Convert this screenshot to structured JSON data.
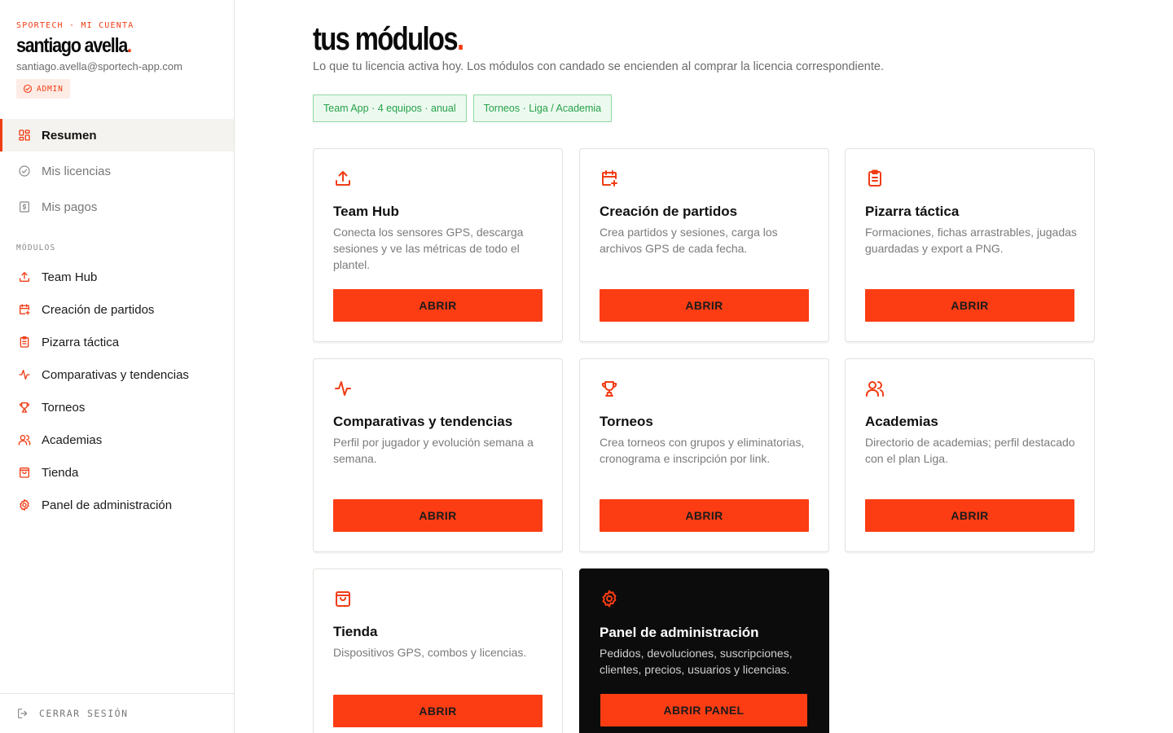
{
  "colors": {
    "accent": "#fc3d14",
    "chip_text": "#27a24a",
    "chip_bg": "#ecf9ef",
    "dark_card": "#0c0c0c"
  },
  "sidebar": {
    "eyebrow": "SPORTECH · MI CUENTA",
    "user_name": "santiago avella",
    "user_name_dot": ".",
    "email": "santiago.avella@sportech-app.com",
    "role_badge": "ADMIN",
    "account_nav": [
      {
        "label": "Resumen",
        "icon": "dashboard-grid-icon",
        "active": true
      },
      {
        "label": "Mis licencias",
        "icon": "check-circle-icon"
      },
      {
        "label": "Mis pagos",
        "icon": "receipt-dollar-icon"
      }
    ],
    "modules_label": "MÓDULOS",
    "modules_nav": [
      {
        "label": "Team Hub",
        "icon": "upload-icon"
      },
      {
        "label": "Creación de partidos",
        "icon": "calendar-plus-icon"
      },
      {
        "label": "Pizarra táctica",
        "icon": "clipboard-icon"
      },
      {
        "label": "Comparativas y tendencias",
        "icon": "activity-icon"
      },
      {
        "label": "Torneos",
        "icon": "trophy-icon"
      },
      {
        "label": "Academias",
        "icon": "users-icon"
      },
      {
        "label": "Tienda",
        "icon": "shopping-bag-icon"
      },
      {
        "label": "Panel de administración",
        "icon": "gear-icon"
      }
    ],
    "logout_label": "CERRAR SESIÓN"
  },
  "main": {
    "title": "tus módulos",
    "title_dot": ".",
    "subtitle": "Lo que tu licencia activa hoy. Los módulos con candado se encienden al comprar la licencia correspondiente.",
    "chips": [
      "Team App · 4 equipos · anual",
      "Torneos · Liga / Academia"
    ],
    "cards": [
      {
        "title": "Team Hub",
        "description": "Conecta los sensores GPS, descarga sesiones y ve las métricas de todo el plantel.",
        "button": "ABRIR",
        "icon": "upload-icon"
      },
      {
        "title": "Creación de partidos",
        "description": "Crea partidos y sesiones, carga los archivos GPS de cada fecha.",
        "button": "ABRIR",
        "icon": "calendar-plus-icon"
      },
      {
        "title": "Pizarra táctica",
        "description": "Formaciones, fichas arrastrables, jugadas guardadas y export a PNG.",
        "button": "ABRIR",
        "icon": "clipboard-icon"
      },
      {
        "title": "Comparativas y tendencias",
        "description": "Perfil por jugador y evolución semana a semana.",
        "button": "ABRIR",
        "icon": "activity-icon"
      },
      {
        "title": "Torneos",
        "description": "Crea torneos con grupos y eliminatorias, cronograma e inscripción por link.",
        "button": "ABRIR",
        "icon": "trophy-icon"
      },
      {
        "title": "Academias",
        "description": "Directorio de academias; perfil destacado con el plan Liga.",
        "button": "ABRIR",
        "icon": "users-icon"
      },
      {
        "title": "Tienda",
        "description": "Dispositivos GPS, combos y licencias.",
        "button": "ABRIR",
        "icon": "shopping-bag-icon"
      },
      {
        "title": "Panel de administración",
        "description": "Pedidos, devoluciones, suscripciones, clientes, precios, usuarios y licencias.",
        "button": "ABRIR PANEL",
        "icon": "gear-icon"
      }
    ]
  }
}
